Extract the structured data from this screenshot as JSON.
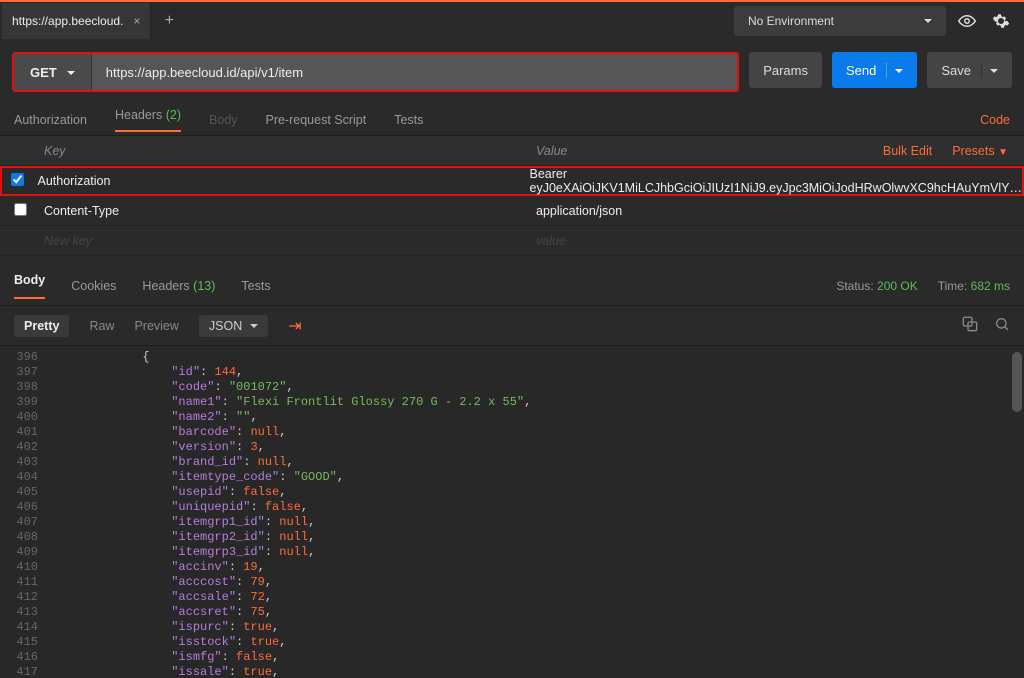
{
  "tabs": {
    "active": "https://app.beecloud.",
    "add_icon": "+"
  },
  "environment": {
    "label": "No Environment"
  },
  "request": {
    "method": "GET",
    "url": "https://app.beecloud.id/api/v1/item",
    "params_btn": "Params",
    "send_btn": "Send",
    "save_btn": "Save"
  },
  "req_tabs": {
    "authorization": "Authorization",
    "headers_label": "Headers",
    "headers_count": "(2)",
    "body": "Body",
    "prereq": "Pre-request Script",
    "tests": "Tests",
    "code": "Code"
  },
  "headers_table": {
    "col_key": "Key",
    "col_value": "Value",
    "bulk_edit": "Bulk Edit",
    "presets": "Presets",
    "rows": [
      {
        "checked": true,
        "key": "Authorization",
        "value": "Bearer eyJ0eXAiOiJKV1MiLCJhbGciOiJIUzI1NiJ9.eyJpc3MiOiJodHRwOlwvXC9hcHAuYmVlY…"
      },
      {
        "checked": false,
        "key": "Content-Type",
        "value": "application/json"
      }
    ],
    "placeholder": {
      "key": "New key",
      "value": "value"
    }
  },
  "resp_tabs": {
    "body": "Body",
    "cookies": "Cookies",
    "headers_label": "Headers",
    "headers_count": "(13)",
    "tests": "Tests",
    "status_label": "Status:",
    "status_value": "200 OK",
    "time_label": "Time:",
    "time_value": "682 ms"
  },
  "viewer": {
    "pretty": "Pretty",
    "raw": "Raw",
    "preview": "Preview",
    "format": "JSON"
  },
  "code_lines": [
    {
      "n": 396,
      "indent": 3,
      "t": "{"
    },
    {
      "n": 397,
      "indent": 4,
      "k": "id",
      "vtype": "num",
      "v": "144",
      "comma": true
    },
    {
      "n": 398,
      "indent": 4,
      "k": "code",
      "vtype": "str",
      "v": "\"001072\"",
      "comma": true
    },
    {
      "n": 399,
      "indent": 4,
      "k": "name1",
      "vtype": "str",
      "v": "\"Flexi Frontlit Glossy 270 G - 2.2 x 55\"",
      "comma": true
    },
    {
      "n": 400,
      "indent": 4,
      "k": "name2",
      "vtype": "str",
      "v": "\"\"",
      "comma": true
    },
    {
      "n": 401,
      "indent": 4,
      "k": "barcode",
      "vtype": "null",
      "v": "null",
      "comma": true
    },
    {
      "n": 402,
      "indent": 4,
      "k": "version",
      "vtype": "num",
      "v": "3",
      "comma": true
    },
    {
      "n": 403,
      "indent": 4,
      "k": "brand_id",
      "vtype": "null",
      "v": "null",
      "comma": true
    },
    {
      "n": 404,
      "indent": 4,
      "k": "itemtype_code",
      "vtype": "str",
      "v": "\"GOOD\"",
      "comma": true
    },
    {
      "n": 405,
      "indent": 4,
      "k": "usepid",
      "vtype": "bool",
      "v": "false",
      "comma": true
    },
    {
      "n": 406,
      "indent": 4,
      "k": "uniquepid",
      "vtype": "bool",
      "v": "false",
      "comma": true
    },
    {
      "n": 407,
      "indent": 4,
      "k": "itemgrp1_id",
      "vtype": "null",
      "v": "null",
      "comma": true
    },
    {
      "n": 408,
      "indent": 4,
      "k": "itemgrp2_id",
      "vtype": "null",
      "v": "null",
      "comma": true
    },
    {
      "n": 409,
      "indent": 4,
      "k": "itemgrp3_id",
      "vtype": "null",
      "v": "null",
      "comma": true
    },
    {
      "n": 410,
      "indent": 4,
      "k": "accinv",
      "vtype": "num",
      "v": "19",
      "comma": true
    },
    {
      "n": 411,
      "indent": 4,
      "k": "acccost",
      "vtype": "num",
      "v": "79",
      "comma": true
    },
    {
      "n": 412,
      "indent": 4,
      "k": "accsale",
      "vtype": "num",
      "v": "72",
      "comma": true
    },
    {
      "n": 413,
      "indent": 4,
      "k": "accsret",
      "vtype": "num",
      "v": "75",
      "comma": true
    },
    {
      "n": 414,
      "indent": 4,
      "k": "ispurc",
      "vtype": "bool",
      "v": "true",
      "comma": true
    },
    {
      "n": 415,
      "indent": 4,
      "k": "isstock",
      "vtype": "bool",
      "v": "true",
      "comma": true
    },
    {
      "n": 416,
      "indent": 4,
      "k": "ismfg",
      "vtype": "bool",
      "v": "false",
      "comma": true
    },
    {
      "n": 417,
      "indent": 4,
      "k": "issale",
      "vtype": "bool",
      "v": "true",
      "comma": true
    }
  ]
}
